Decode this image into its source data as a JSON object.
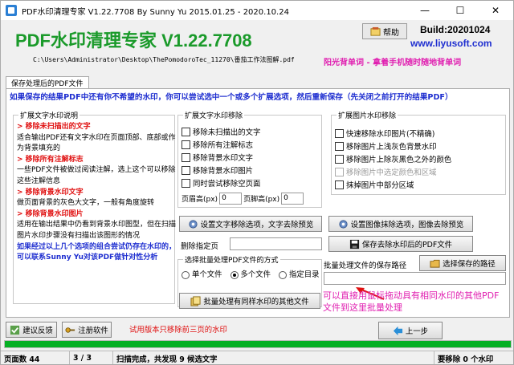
{
  "window": {
    "title": "PDF水印清理专家 V1.22.7708 By Sunny Yu 2015.01.25 - 2020.10.24",
    "min": "—",
    "max": "☐",
    "close": "✕"
  },
  "header": {
    "app_title": "PDF水印清理专家 V1.22.7708",
    "file_path": "C:\\Users\\Administrator\\Desktop\\ThePomodoroTec_11270\\番茄工作法图解.pdf",
    "help_label": "帮助",
    "build": "Build:20201024",
    "site": "www.liyusoft.com",
    "promo": "阳光背单词 - 拿着手机随时随地背单词"
  },
  "tab": {
    "label": "保存处理后的PDF文件"
  },
  "tip": "如果保存的结果PDF中还有你不希望的水印，你可以尝试选中一个或多个扩展选项，然后重新保存（先关闭之前打开的结果PDF）",
  "explain": {
    "title": "扩展文字水印说明",
    "items": [
      {
        "type": "h",
        "text": "> 移除未扫描出的文字"
      },
      {
        "type": "t",
        "text": "  适合输出PDF还有文字水印在页面顶部、底部或作为背景填充的"
      },
      {
        "type": "h",
        "text": "> 移除所有注解标志"
      },
      {
        "type": "t",
        "text": "  一些PDF文件被做过阅读注解，选上这个可以移除这些注解信息"
      },
      {
        "type": "h",
        "text": "> 移除背景水印文字"
      },
      {
        "type": "t",
        "text": "  做页面背景的灰色大文字，一般有角度旋转"
      },
      {
        "type": "h",
        "text": "> 移除背景水印图片"
      },
      {
        "type": "t",
        "text": "  适用在输出结果中仍看到背景水印图型，但在扫描图片水印步骤没有扫描出该图形的情况"
      },
      {
        "type": "b",
        "text": "如果经过以上几个选项的组合尝试仍存在水印的，可以联系Sunny Yu对该PDF做针对性分析"
      }
    ]
  },
  "text_opts": {
    "title": "扩展文字水印移除",
    "items": [
      "移除未扫描出的文字",
      "移除所有注解标志",
      "移除背景水印文字",
      "移除背景水印图片",
      "同时尝试移除空页面"
    ],
    "header_label": "页眉高(px)",
    "header_value": "0",
    "footer_label": "页脚高(px)",
    "footer_value": "0",
    "apply_label": "设置文字移除选项，文字去除预览"
  },
  "img_opts": {
    "title": "扩展图片水印移除",
    "items": [
      "快速移除水印图片(不精确)",
      "移除图片上浅灰色背景水印",
      "移除图片上除灰黑色之外的颜色",
      "移除图片中选定颜色和区域",
      "抹掉图片中部分区域"
    ],
    "apply_label": "设置图像抹除选项，图像去除预览"
  },
  "delete_pages_label": "删除指定页",
  "save_label": "保存去除水印后的PDF文件",
  "batch": {
    "title": "选择批量处理PDF文件的方式",
    "opt1": "单个文件",
    "opt2": "多个文件",
    "opt3": "指定目录",
    "run_label": "批量处理有同样水印的其他文件"
  },
  "save_path": {
    "label": "批量处理文件的保存路径",
    "choose_label": "选择保存的路径"
  },
  "drag_hint": "可以直接用鼠标拖动具有相同水印的其他PDF文件到这里批量处理",
  "trial": "试用版本只移除前三页的水印",
  "footer_btns": {
    "feedback": "建议反馈",
    "register": "注册软件",
    "prev": "上一步"
  },
  "progress_fraction": 1.0,
  "status": {
    "pages": "页面数 44",
    "ratio": "3 / 3",
    "msg": "扫描完成，共发现 9 候选文字",
    "remove": "要移除 0 个水印"
  },
  "colors": {
    "title_green": "#1a9a2a",
    "link_blue": "#1f2fd0",
    "promo_pink": "#e01fb0",
    "alert_red": "#e01010"
  }
}
